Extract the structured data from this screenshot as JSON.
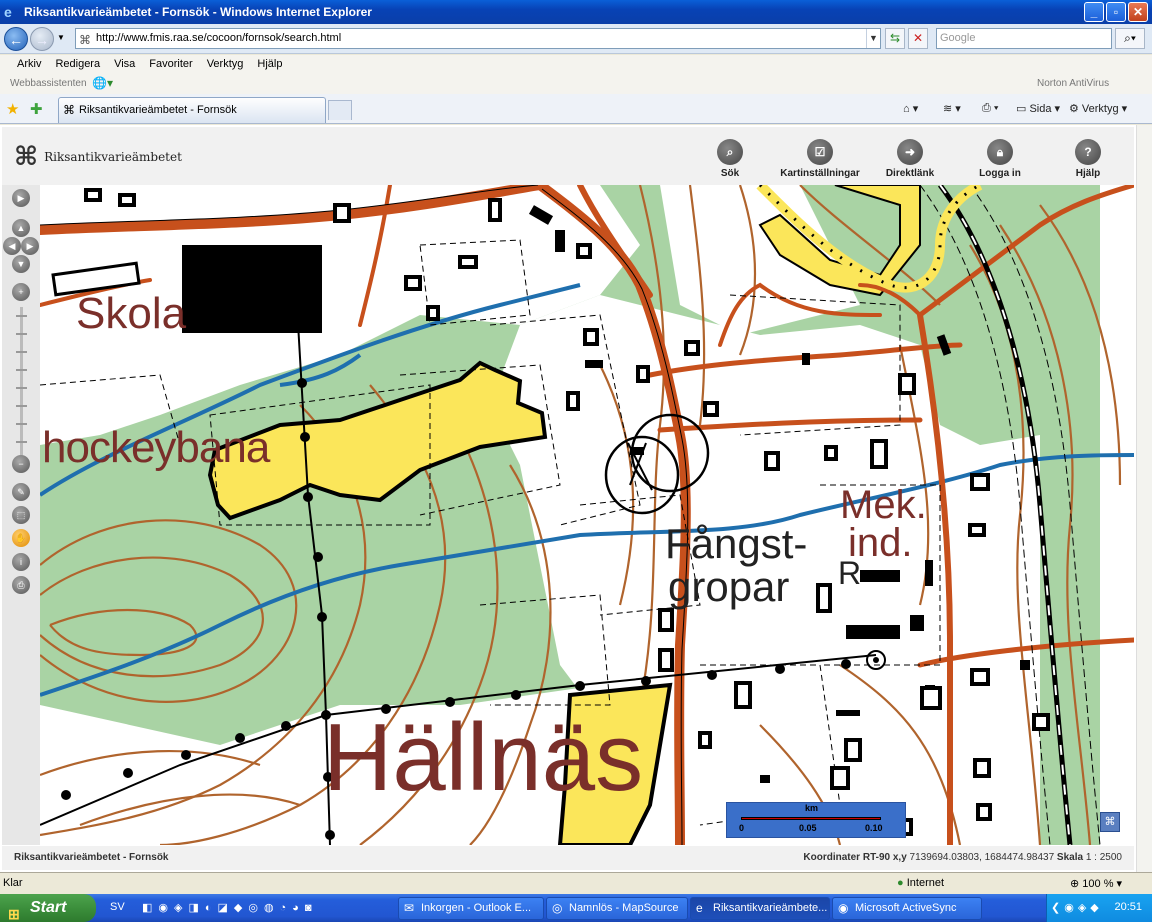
{
  "window": {
    "title": "Riksantikvarieämbetet - Fornsök - Windows Internet Explorer"
  },
  "address": {
    "url": "http://www.fmis.raa.se/cocoon/fornsok/search.html",
    "search_placeholder": "Google"
  },
  "menu": [
    "Arkiv",
    "Redigera",
    "Visa",
    "Favoriter",
    "Verktyg",
    "Hjälp"
  ],
  "links": {
    "label": "Webbassistenten",
    "norton": "Norton AntiVirus"
  },
  "tab": {
    "label": "Riksantikvarieämbetet - Fornsök"
  },
  "commandbar": {
    "page": "Sida",
    "tools": "Verktyg"
  },
  "app": {
    "logo": "Riksantikvarieämbetet",
    "tools": [
      {
        "label": "Sök",
        "icon": "search-icon"
      },
      {
        "label": "Kartinställningar",
        "icon": "checkbox-icon"
      },
      {
        "label": "Direktlänk",
        "icon": "arrow-right-icon"
      },
      {
        "label": "Logga in",
        "icon": "lock-icon"
      },
      {
        "label": "Hjälp",
        "icon": "question-icon"
      }
    ],
    "footer_left": "Riksantikvarieämbetet - Fornsök",
    "coord_label": "Koordinater RT-90 x,y",
    "coord_value": "7139694.03803, 1684474.98437",
    "scale_label": "Skala",
    "scale_value": "1 : 2500"
  },
  "map": {
    "labels": {
      "skola": "Skola",
      "hockey": "hockeybana",
      "mek1": "Mek.",
      "mek2": "ind.",
      "fangst1": "Fångst-",
      "fangst2": "gropar",
      "hallnas": "Hällnäs",
      "r": "R"
    },
    "scalebar": {
      "unit": "km",
      "ticks": [
        "0",
        "0.05",
        "0.10"
      ]
    }
  },
  "status": {
    "left": "Klar",
    "zone": "Internet",
    "zoom": "100 %"
  },
  "taskbar": {
    "start": "Start",
    "lang": "SV",
    "tasks": [
      "Inkorgen - Outlook E...",
      "Namnlös - MapSource",
      "Riksantikvarieämbete...",
      "Microsoft ActiveSync"
    ],
    "clock": "20:51"
  },
  "colors": {
    "forest": "#a9d3a4",
    "open_land": "#ffffff",
    "road": "#c7501c",
    "contour": "#b0642d",
    "water": "#1f6fae",
    "yellow_area": "#fbe65a",
    "label": "#7a2f2a"
  }
}
